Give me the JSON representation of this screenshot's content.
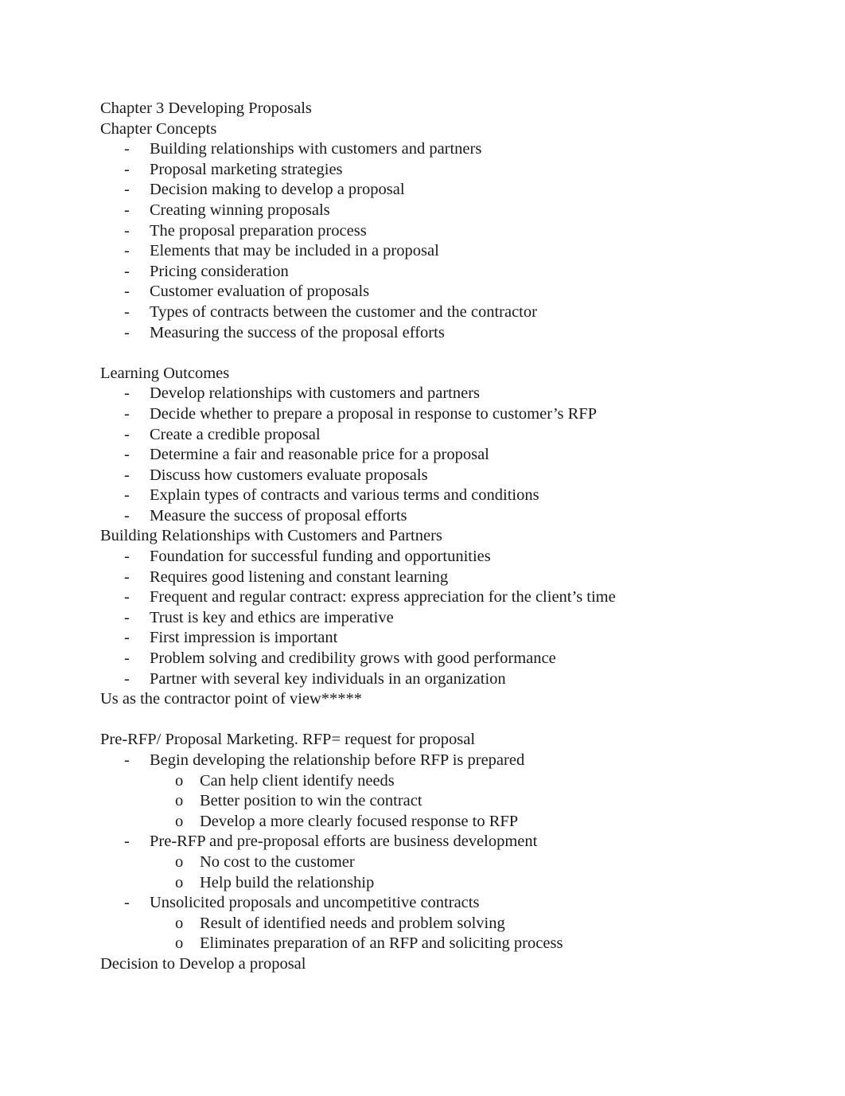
{
  "document": {
    "title": "Chapter 3 Developing Proposals",
    "sections": [
      {
        "heading": "Chapter Concepts",
        "items": [
          {
            "text": "Building relationships with customers and partners"
          },
          {
            "text": "Proposal marketing strategies"
          },
          {
            "text": "Decision making to develop a proposal"
          },
          {
            "text": "Creating winning proposals"
          },
          {
            "text": "The proposal preparation process"
          },
          {
            "text": "Elements that may be included in a proposal"
          },
          {
            "text": "Pricing consideration"
          },
          {
            "text": "Customer evaluation of proposals"
          },
          {
            "text": "Types of contracts between the customer and the contractor"
          },
          {
            "text": "Measuring the success of the proposal efforts"
          }
        ]
      },
      {
        "heading": "Learning Outcomes",
        "items": [
          {
            "text": "Develop relationships with customers and partners"
          },
          {
            "text": "Decide whether to prepare a proposal in response to customer’s RFP"
          },
          {
            "text": "Create a credible proposal"
          },
          {
            "text": "Determine a fair and reasonable price for a proposal"
          },
          {
            "text": "Discuss how customers evaluate proposals"
          },
          {
            "text": "Explain types of contracts and various terms and conditions"
          },
          {
            "text": "Measure the success of proposal efforts"
          }
        ]
      },
      {
        "heading": "Building Relationships with Customers and Partners",
        "items": [
          {
            "text": "Foundation for successful funding and opportunities"
          },
          {
            "text": "Requires good listening and constant learning"
          },
          {
            "text": "Frequent and regular contract: express appreciation for the client’s time"
          },
          {
            "text": "Trust is key and ethics are imperative"
          },
          {
            "text": "First impression is important"
          },
          {
            "text": "Problem solving and credibility grows with good performance"
          },
          {
            "text": "Partner with several key individuals in an organization"
          }
        ],
        "note": "Us as the contractor point of view*****"
      },
      {
        "heading": "Pre-RFP/ Proposal Marketing. RFP= request for proposal",
        "items": [
          {
            "text": "Begin developing the relationship before RFP is prepared",
            "subitems": [
              "Can help client identify needs",
              "Better position to win the contract",
              "Develop a more clearly focused response to RFP"
            ]
          },
          {
            "text": "Pre-RFP and pre-proposal efforts are business development",
            "subitems": [
              "No cost to the customer",
              "Help build the relationship"
            ]
          },
          {
            "text": "Unsolicited proposals and uncompetitive contracts",
            "subitems": [
              "Result of identified needs and problem solving",
              "Eliminates preparation of an RFP and soliciting process"
            ]
          }
        ]
      },
      {
        "heading": "Decision to Develop a proposal",
        "items": []
      }
    ],
    "bullet_l1": "-",
    "bullet_l2": "o"
  }
}
